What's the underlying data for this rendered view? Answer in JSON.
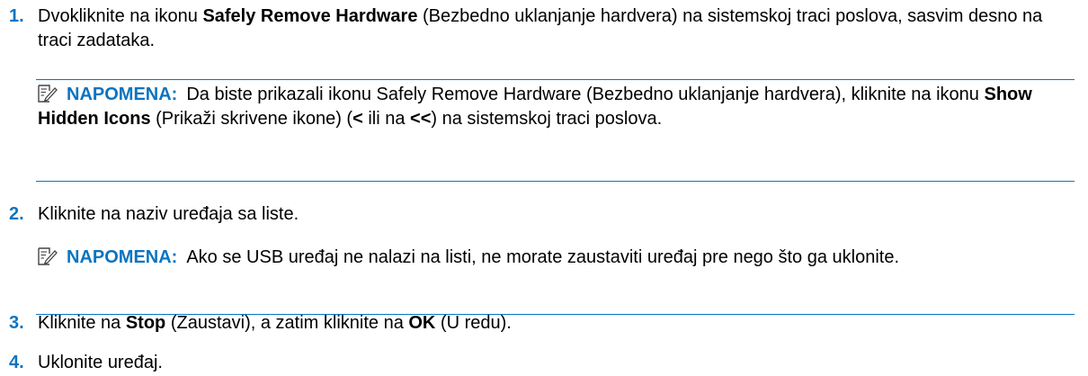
{
  "steps": [
    {
      "num": "1.",
      "parts": [
        "Dvokliknite na ikonu ",
        "Safely Remove Hardware",
        " (Bezbedno uklanjanje hardvera) na sistemskoj traci poslova, sasvim desno na traci zadataka."
      ]
    },
    {
      "num": "2.",
      "text": "Kliknite na naziv uređaja sa liste."
    },
    {
      "num": "3.",
      "parts": [
        "Kliknite na ",
        "Stop",
        " (Zaustavi), a zatim kliknite na ",
        "OK",
        " (U redu)."
      ]
    },
    {
      "num": "4.",
      "text": "Uklonite uređaj."
    }
  ],
  "notes": [
    {
      "label": "NAPOMENA:",
      "parts": [
        "Da biste prikazali ikonu Safely Remove Hardware (Bezbedno uklanjanje hardvera), kliknite na ikonu ",
        "Show Hidden Icons",
        " (Prikaži skrivene ikone) (",
        "<",
        " ili na ",
        "<<",
        ") na sistemskoj traci poslova."
      ]
    },
    {
      "label": "NAPOMENA:",
      "text": "Ako se USB uređaj ne nalazi na listi, ne morate zaustaviti uređaj pre nego što ga uklonite."
    }
  ],
  "colors": {
    "accent": "#0b74c1",
    "text": "#000000"
  },
  "icons": {
    "note": "note-pencil-icon"
  }
}
